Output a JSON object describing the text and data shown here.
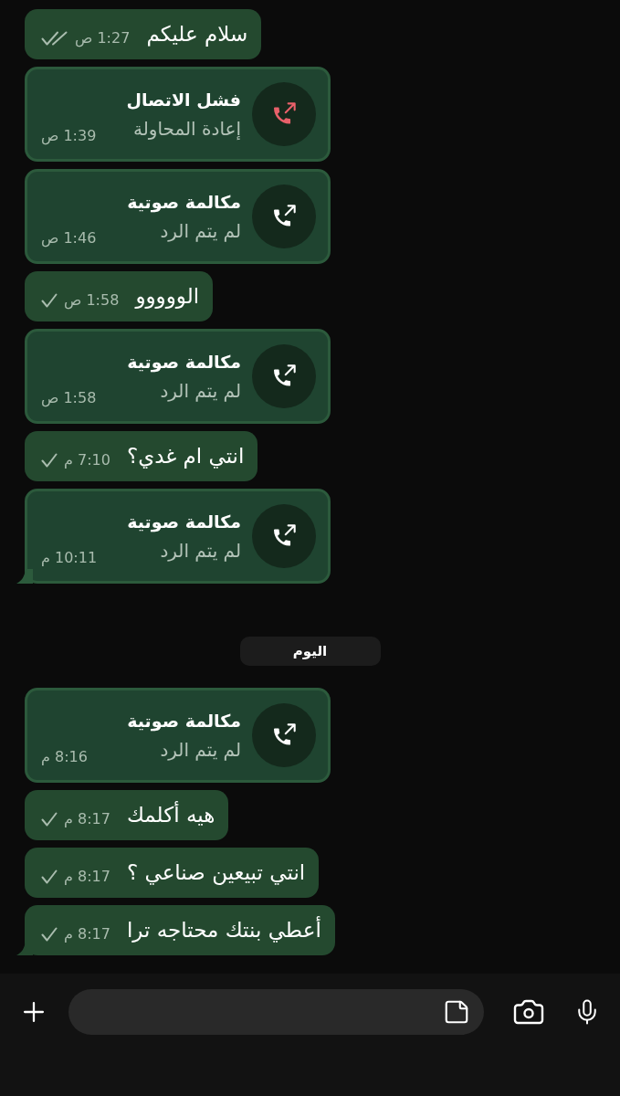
{
  "messages": [
    {
      "kind": "text",
      "text": "سلام عليكم",
      "time": "1:27 ص",
      "delivered": true,
      "tail": false
    },
    {
      "kind": "call",
      "title": "فشل الاتصال",
      "subtitle": "إعادة المحاولة",
      "time": "1:39 ص",
      "failed": true,
      "tail": false
    },
    {
      "kind": "call",
      "title": "مكالمة صوتية",
      "subtitle": "لم يتم الرد",
      "time": "1:46 ص",
      "failed": false,
      "tail": false
    },
    {
      "kind": "text",
      "text": "الووووو",
      "time": "1:58 ص",
      "delivered": false,
      "tail": false
    },
    {
      "kind": "call",
      "title": "مكالمة صوتية",
      "subtitle": "لم يتم الرد",
      "time": "1:58 ص",
      "failed": false,
      "tail": false
    },
    {
      "kind": "text",
      "text": "انتي ام غدي؟",
      "time": "7:10 م",
      "delivered": false,
      "tail": false
    },
    {
      "kind": "call",
      "title": "مكالمة صوتية",
      "subtitle": "لم يتم الرد",
      "time": "10:11 م",
      "failed": false,
      "tail": true
    },
    {
      "kind": "date",
      "text": "اليوم"
    },
    {
      "kind": "call",
      "title": "مكالمة صوتية",
      "subtitle": "لم يتم الرد",
      "time": "8:16 م",
      "failed": false,
      "tail": false
    },
    {
      "kind": "text",
      "text": "هيه أكلمك",
      "time": "8:17 م",
      "delivered": false,
      "tail": false
    },
    {
      "kind": "text",
      "text": "انتي تبيعين صناعي ؟",
      "time": "8:17 م",
      "delivered": false,
      "tail": false
    },
    {
      "kind": "text",
      "text": "أعطي بنتك محتاجه ترا",
      "time": "8:17 م",
      "delivered": false,
      "tail": true
    }
  ]
}
